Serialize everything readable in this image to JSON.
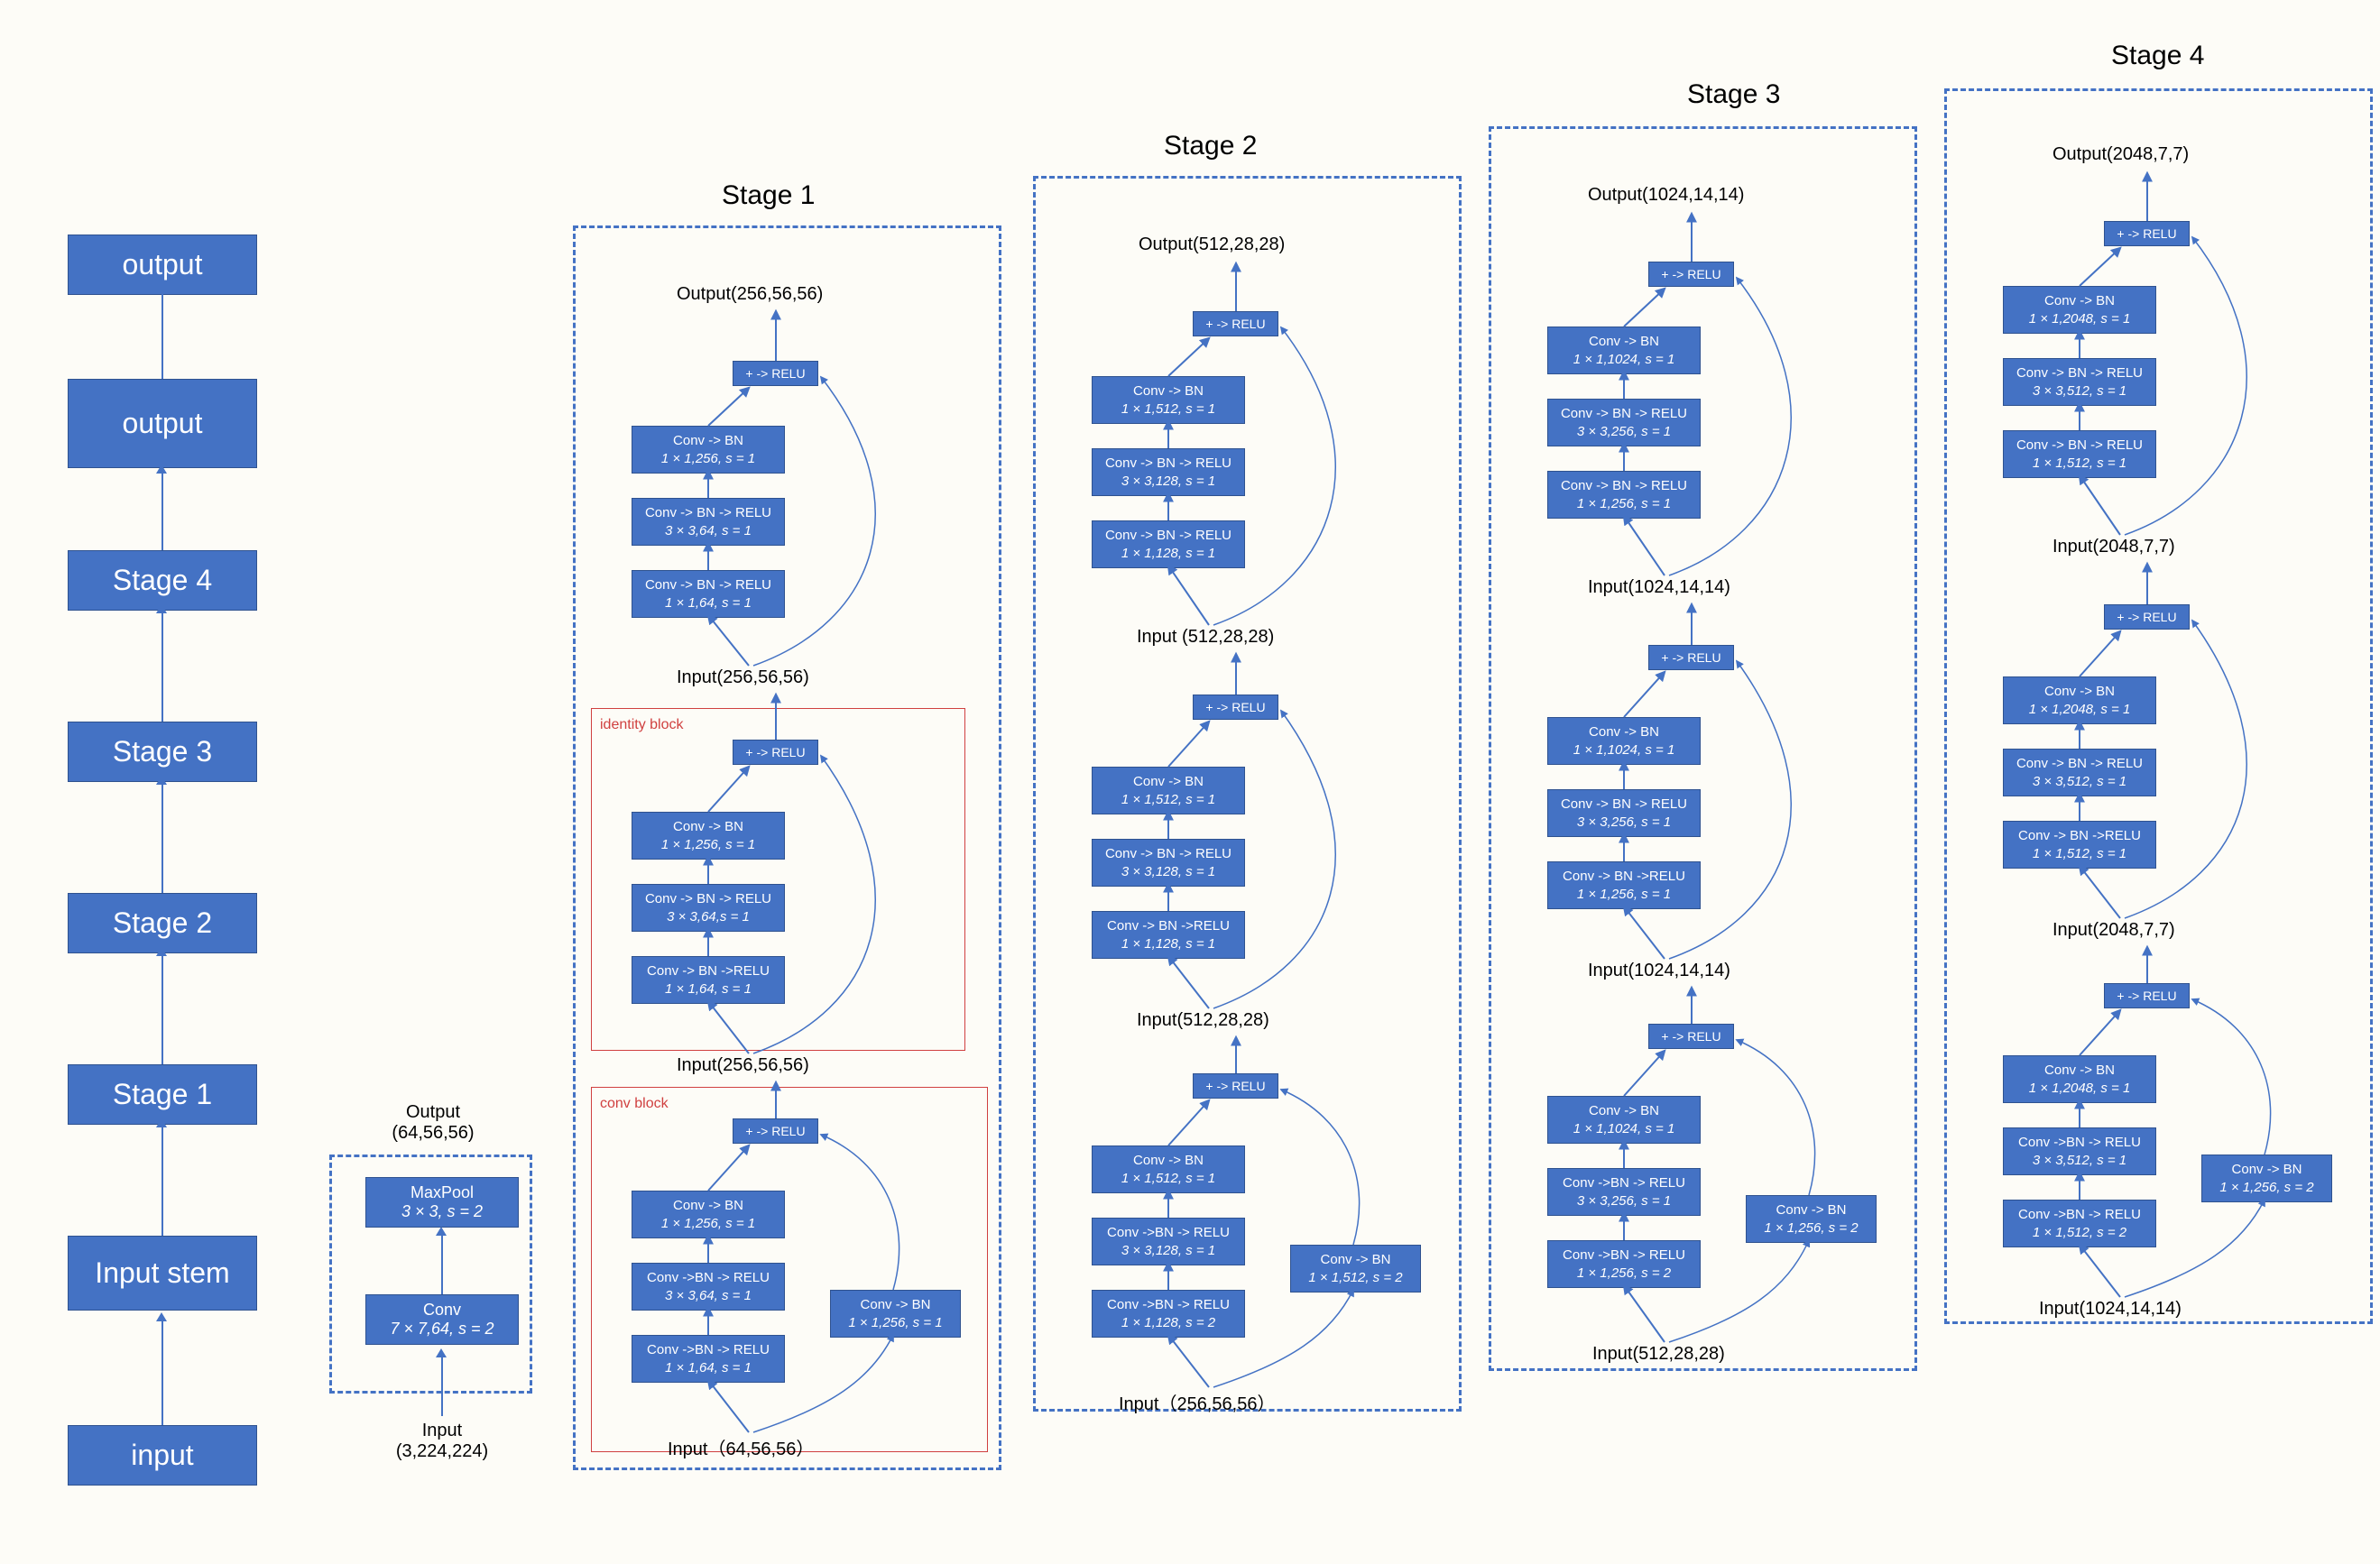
{
  "overview": {
    "items": [
      "output",
      "output",
      "Stage 4",
      "Stage 3",
      "Stage 2",
      "Stage 1",
      "Input stem",
      "input"
    ]
  },
  "stem": {
    "out": "Output\n(64,56,56)",
    "maxpool_l1": "MaxPool",
    "maxpool_l2": "3 × 3, s = 2",
    "conv_l1": "Conv",
    "conv_l2": "7 × 7,64, s = 2",
    "in": "Input\n(3,224,224)"
  },
  "stage1": {
    "title": "Stage 1",
    "identity_label": "identity block",
    "conv_label": "conv block",
    "out": "Output(256,56,56)",
    "mid2": "Input(256,56,56)",
    "mid1": "Input(256,56,56)",
    "in": "Input（64,56,56）",
    "relu": "+ -> RELU",
    "b3_c3_l1": "Conv -> BN",
    "b3_c3_l2": "1 × 1,256, s = 1",
    "b3_c2_l1": "Conv -> BN -> RELU",
    "b3_c2_l2": "3 × 3,64, s = 1",
    "b3_c1_l1": "Conv -> BN -> RELU",
    "b3_c1_l2": "1 × 1,64, s = 1",
    "b2_c3_l1": "Conv -> BN",
    "b2_c3_l2": "1 × 1,256, s = 1",
    "b2_c2_l1": "Conv -> BN -> RELU",
    "b2_c2_l2": "3 × 3,64,s = 1",
    "b2_c1_l1": "Conv -> BN ->RELU",
    "b2_c1_l2": "1 × 1,64, s = 1",
    "b1_c3_l1": "Conv -> BN",
    "b1_c3_l2": "1 × 1,256, s = 1",
    "b1_c2_l1": "Conv ->BN -> RELU",
    "b1_c2_l2": "3 × 3,64, s = 1",
    "b1_c1_l1": "Conv ->BN -> RELU",
    "b1_c1_l2": "1 × 1,64, s = 1",
    "b1_sc_l1": "Conv -> BN",
    "b1_sc_l2": "1 × 1,256, s = 1"
  },
  "stage2": {
    "title": "Stage 2",
    "out": "Output(512,28,28)",
    "mid2": "Input (512,28,28)",
    "mid1": "Input(512,28,28)",
    "in": "Input（256,56,56）",
    "relu": "+ -> RELU",
    "b3_c3_l1": "Conv -> BN",
    "b3_c3_l2": "1 × 1,512, s = 1",
    "b3_c2_l1": "Conv -> BN -> RELU",
    "b3_c2_l2": "3 × 3,128, s = 1",
    "b3_c1_l1": "Conv -> BN -> RELU",
    "b3_c1_l2": "1 × 1,128, s = 1",
    "b2_c3_l1": "Conv -> BN",
    "b2_c3_l2": "1 × 1,512, s = 1",
    "b2_c2_l1": "Conv -> BN -> RELU",
    "b2_c2_l2": "3 × 3,128, s = 1",
    "b2_c1_l1": "Conv -> BN ->RELU",
    "b2_c1_l2": "1 × 1,128, s = 1",
    "b1_c3_l1": "Conv -> BN",
    "b1_c3_l2": "1 × 1,512, s = 1",
    "b1_c2_l1": "Conv ->BN -> RELU",
    "b1_c2_l2": "3 × 3,128, s = 1",
    "b1_c1_l1": "Conv ->BN -> RELU",
    "b1_c1_l2": "1 × 1,128, s = 2",
    "b1_sc_l1": "Conv -> BN",
    "b1_sc_l2": "1 × 1,512, s = 2"
  },
  "stage3": {
    "title": "Stage 3",
    "out": "Output(1024,14,14)",
    "mid2": "Input(1024,14,14)",
    "mid1": "Input(1024,14,14)",
    "in": "Input(512,28,28)",
    "relu": "+ -> RELU",
    "b3_c3_l1": "Conv -> BN",
    "b3_c3_l2": "1 × 1,1024, s = 1",
    "b3_c2_l1": "Conv -> BN -> RELU",
    "b3_c2_l2": "3 × 3,256, s = 1",
    "b3_c1_l1": "Conv -> BN -> RELU",
    "b3_c1_l2": "1 × 1,256, s = 1",
    "b2_c3_l1": "Conv -> BN",
    "b2_c3_l2": "1 × 1,1024, s = 1",
    "b2_c2_l1": "Conv -> BN -> RELU",
    "b2_c2_l2": "3 × 3,256, s = 1",
    "b2_c1_l1": "Conv -> BN ->RELU",
    "b2_c1_l2": "1 × 1,256, s = 1",
    "b1_c3_l1": "Conv -> BN",
    "b1_c3_l2": "1 × 1,1024, s = 1",
    "b1_c2_l1": "Conv ->BN -> RELU",
    "b1_c2_l2": "3 × 3,256, s = 1",
    "b1_c1_l1": "Conv ->BN -> RELU",
    "b1_c1_l2": "1 × 1,256, s = 2",
    "b1_sc_l1": "Conv -> BN",
    "b1_sc_l2": "1 × 1,256, s = 2"
  },
  "stage4": {
    "title": "Stage 4",
    "out": "Output(2048,7,7)",
    "mid2": "Input(2048,7,7)",
    "mid1": "Input(2048,7,7)",
    "in": "Input(1024,14,14)",
    "relu": "+ -> RELU",
    "b3_c3_l1": "Conv -> BN",
    "b3_c3_l2": "1 × 1,2048, s = 1",
    "b3_c2_l1": "Conv -> BN -> RELU",
    "b3_c2_l2": "3 × 3,512, s = 1",
    "b3_c1_l1": "Conv -> BN -> RELU",
    "b3_c1_l2": "1 × 1,512, s = 1",
    "b2_c3_l1": "Conv -> BN",
    "b2_c3_l2": "1 × 1,2048, s = 1",
    "b2_c2_l1": "Conv -> BN -> RELU",
    "b2_c2_l2": "3 × 3,512, s = 1",
    "b2_c1_l1": "Conv -> BN ->RELU",
    "b2_c1_l2": "1 × 1,512, s = 1",
    "b1_c3_l1": "Conv -> BN",
    "b1_c3_l2": "1 × 1,2048, s = 1",
    "b1_c2_l1": "Conv ->BN -> RELU",
    "b1_c2_l2": "3 × 3,512, s = 1",
    "b1_c1_l1": "Conv ->BN -> RELU",
    "b1_c1_l2": "1 × 1,512, s = 2",
    "b1_sc_l1": "Conv -> BN",
    "b1_sc_l2": "1 × 1,256, s = 2"
  }
}
